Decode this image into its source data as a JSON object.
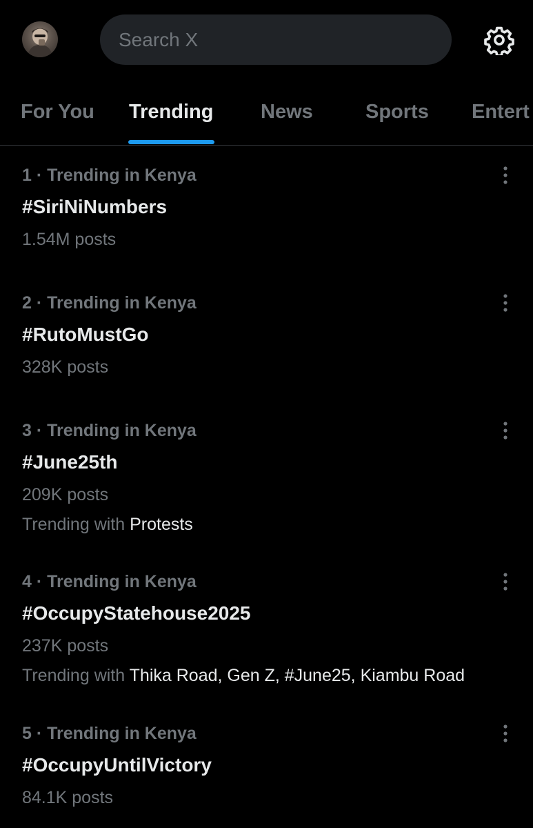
{
  "header": {
    "search_placeholder": "Search X",
    "avatar_icon": "profile-avatar",
    "settings_icon": "gear-icon"
  },
  "tabs": [
    {
      "label": "For You",
      "active": false
    },
    {
      "label": "Trending",
      "active": true
    },
    {
      "label": "News",
      "active": false
    },
    {
      "label": "Sports",
      "active": false
    },
    {
      "label": "Entert",
      "active": false
    }
  ],
  "trends": [
    {
      "meta": "1 · Trending in Kenya",
      "tag": "#SiriNiNumbers",
      "count": "1.54M posts"
    },
    {
      "meta": "2 · Trending in Kenya",
      "tag": "#RutoMustGo",
      "count": "328K posts"
    },
    {
      "meta": "3 · Trending in Kenya",
      "tag": "#June25th",
      "count": "209K posts",
      "with_label": "Trending with",
      "with_items": "Protests"
    },
    {
      "meta": "4 · Trending in Kenya",
      "tag": "#OccupyStatehouse2025",
      "count": "237K posts",
      "with_label": "Trending with",
      "with_items": "Thika Road, Gen Z, #June25, Kiambu Road"
    },
    {
      "meta": "5 · Trending in Kenya",
      "tag": "#OccupyUntilVictory",
      "count": "84.1K posts"
    }
  ],
  "colors": {
    "background": "#000000",
    "accent": "#1d9bf0",
    "primary_text": "#e7e9ea",
    "secondary_text": "#71767b",
    "search_bg": "#202327"
  }
}
